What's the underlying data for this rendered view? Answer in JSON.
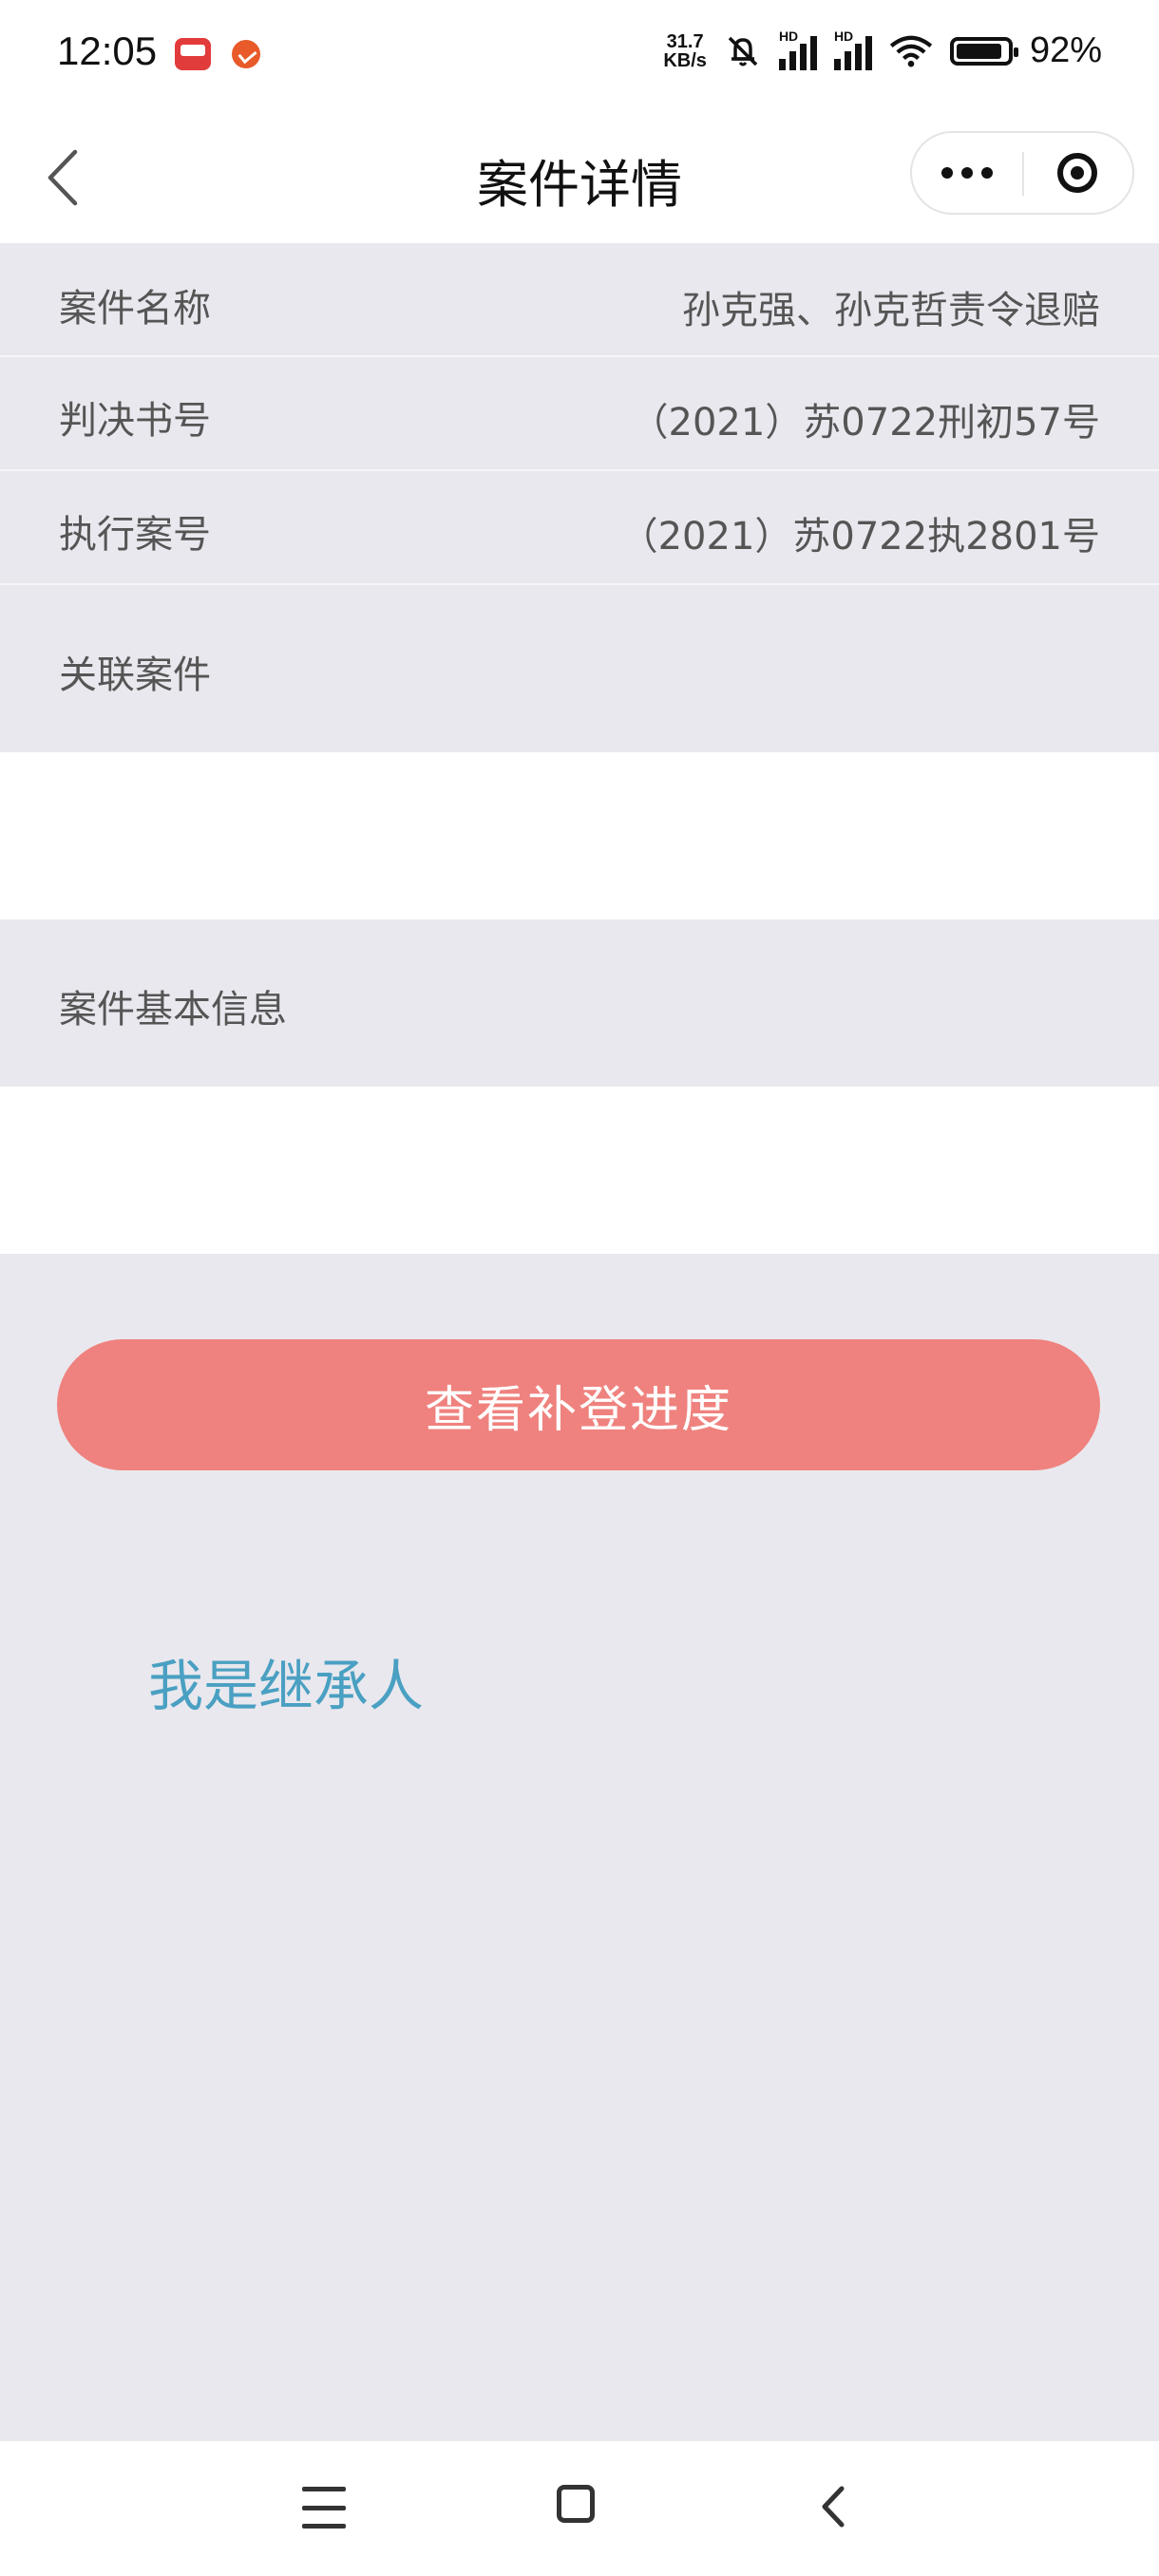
{
  "status_bar": {
    "time": "12:05",
    "net_speed_value": "31.7",
    "net_speed_unit": "KB/s",
    "signal1_tag": "HD",
    "signal2_tag": "HD",
    "battery_percent": "92%",
    "battery_level": 0.92
  },
  "nav": {
    "title": "案件详情"
  },
  "case": {
    "rows": [
      {
        "label": "案件名称",
        "value": "孙克强、孙克哲责令退赔"
      },
      {
        "label": "判决书号",
        "value": "（2021）苏0722刑初57号"
      },
      {
        "label": "执行案号",
        "value": "（2021）苏0722执2801号"
      },
      {
        "label": "关联案件",
        "value": ""
      }
    ],
    "basic_info_label": "案件基本信息"
  },
  "actions": {
    "view_progress": "查看补登进度",
    "i_am_heir": "我是继承人"
  },
  "colors": {
    "accent_button": "#ef827e",
    "link": "#4aa0c2",
    "background": "#e9e8ee"
  }
}
